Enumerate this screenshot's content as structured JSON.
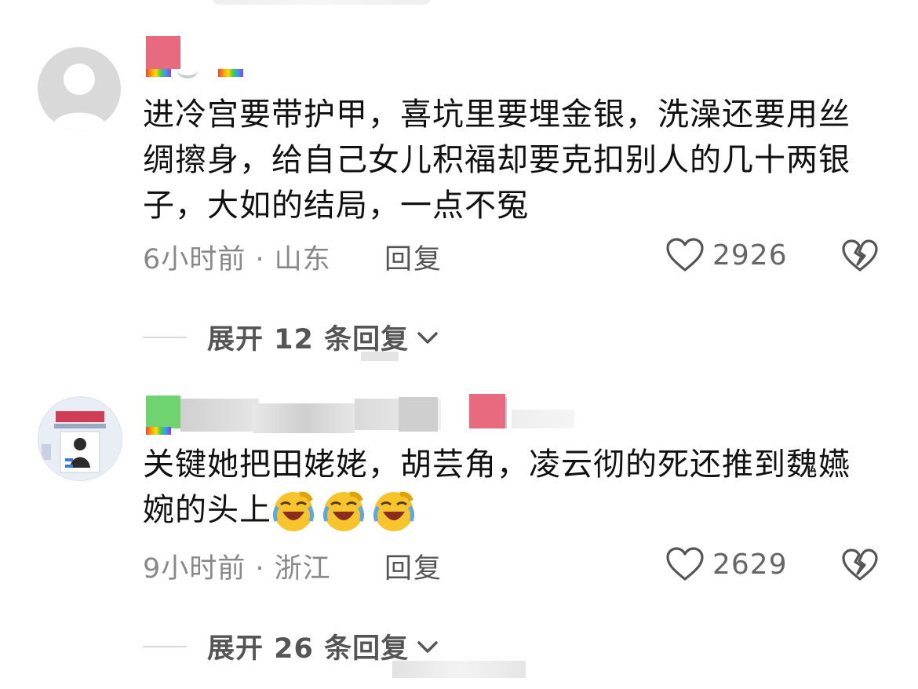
{
  "comments": [
    {
      "text": "进冷宫要带护甲，喜坑里要埋金银，洗澡还要用丝绸擦身，给自己女儿积福却要克扣别人的几十两银子，大如的结局，一点不冤",
      "time": "6小时前",
      "separator": " · ",
      "location": "山东",
      "reply_label": "回复",
      "like_count": "2926",
      "expand_label": "展开 12 条回复",
      "avatar_icon": "default-user-icon"
    },
    {
      "text": "关键她把田姥姥，胡芸角，凌云彻的死还推到魏嬿婉的头上",
      "emoji_icon": "laughing-crying-emoji",
      "time": "9小时前",
      "separator": " · ",
      "location": "浙江",
      "reply_label": "回复",
      "like_count": "2629",
      "expand_label": "展开 26 条回复",
      "avatar_icon": "photo-avatar"
    }
  ],
  "colors": {
    "accent_pink": "#e86a7f",
    "accent_green": "#6fd36f",
    "meta_gray": "#888888",
    "emoji_yellow": "#f7c52b"
  }
}
